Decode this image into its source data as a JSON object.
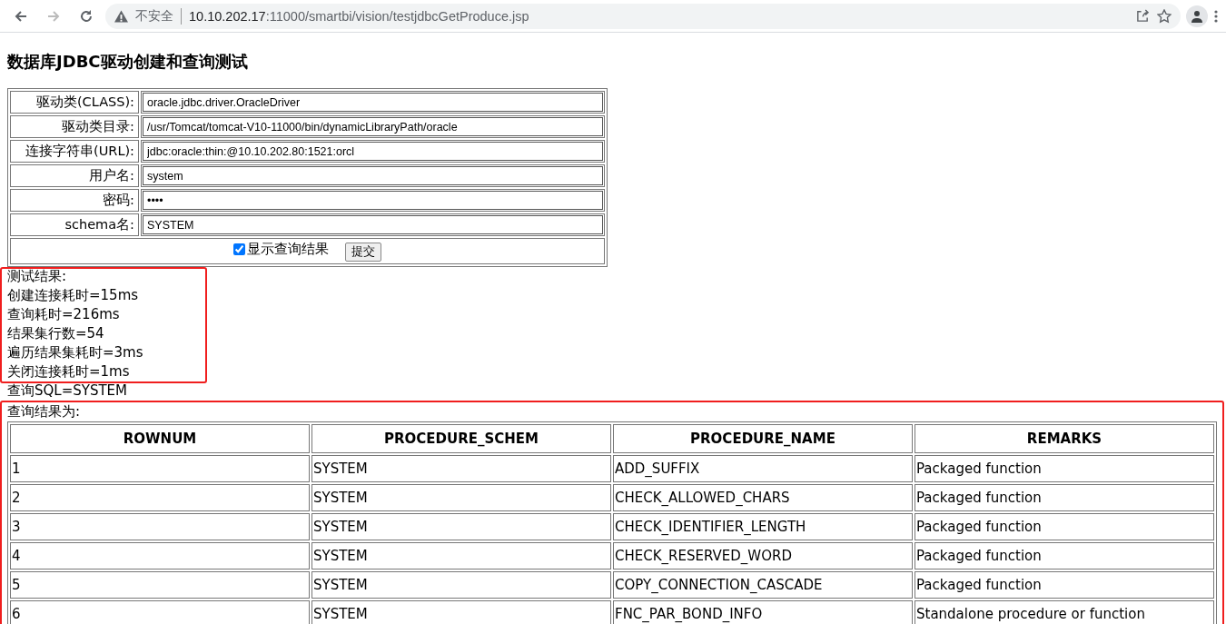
{
  "browser": {
    "security_label": "不安全",
    "url_host": "10.10.202.17",
    "url_rest": ":11000/smartbi/vision/testjdbcGetProduce.jsp"
  },
  "page_title": "数据库JDBC驱动创建和查询测试",
  "form": {
    "fields": [
      {
        "label": "驱动类(CLASS):",
        "value": "oracle.jdbc.driver.OracleDriver"
      },
      {
        "label": "驱动类目录:",
        "value": "/usr/Tomcat/tomcat-V10-11000/bin/dynamicLibraryPath/oracle"
      },
      {
        "label": "连接字符串(URL):",
        "value": "jdbc:oracle:thin:@10.10.202.80:1521:orcl"
      },
      {
        "label": "用户名:",
        "value": "system"
      },
      {
        "label": "密码:",
        "value": "••••"
      },
      {
        "label": "schema名:",
        "value": "SYSTEM"
      }
    ],
    "show_results": {
      "label": "显示查询结果",
      "checked": true
    },
    "submit": "提交"
  },
  "metrics_heading": "测试结果:",
  "metrics": {
    "highlighted": true,
    "lines": [
      "创建连接耗时=15ms",
      "查询耗时=216ms",
      "结果集行数=54",
      "遍历结果集耗时=3ms",
      "关闭连接耗时=1ms"
    ]
  },
  "query_sql": "查询SQL=SYSTEM",
  "results": {
    "highlighted": true,
    "heading": "查询结果为:",
    "columns": [
      "ROWNUM",
      "PROCEDURE_SCHEM",
      "PROCEDURE_NAME",
      "REMARKS"
    ],
    "rows": [
      [
        "1",
        "SYSTEM",
        "ADD_SUFFIX",
        "Packaged function"
      ],
      [
        "2",
        "SYSTEM",
        "CHECK_ALLOWED_CHARS",
        "Packaged function"
      ],
      [
        "3",
        "SYSTEM",
        "CHECK_IDENTIFIER_LENGTH",
        "Packaged function"
      ],
      [
        "4",
        "SYSTEM",
        "CHECK_RESERVED_WORD",
        "Packaged function"
      ],
      [
        "5",
        "SYSTEM",
        "COPY_CONNECTION_CASCADE",
        "Packaged function"
      ],
      [
        "6",
        "SYSTEM",
        "FNC_PAR_BOND_INFO",
        "Standalone procedure or function"
      ]
    ]
  }
}
